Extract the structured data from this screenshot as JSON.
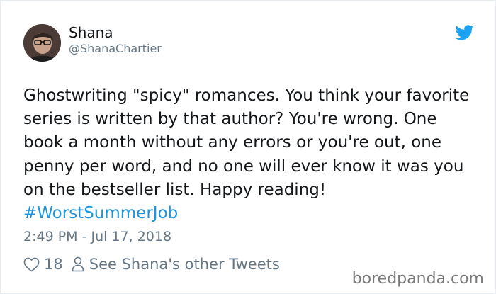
{
  "user": {
    "display_name": "Shana",
    "handle": "@ShanaChartier"
  },
  "tweet": {
    "text": "Ghostwriting \"spicy\" romances. You think your favorite series is written by that author? You're wrong. One book a month without any errors or you're out, one penny per word, and no one will ever know it was you on the bestseller list. Happy reading!",
    "hashtag": "#WorstSummerJob",
    "timestamp": "2:49 PM - Jul 17, 2018"
  },
  "actions": {
    "like_count": "18",
    "profile_link": "See Shana's other Tweets"
  },
  "watermark": "boredpanda.com",
  "icons": {
    "brand": "twitter-bird-icon",
    "like": "heart-icon",
    "profile": "person-icon"
  },
  "colors": {
    "hashtag": "#1b95e0",
    "twitter_blue": "#1da1f2",
    "muted_text": "#657786",
    "body_text": "#14171a"
  }
}
